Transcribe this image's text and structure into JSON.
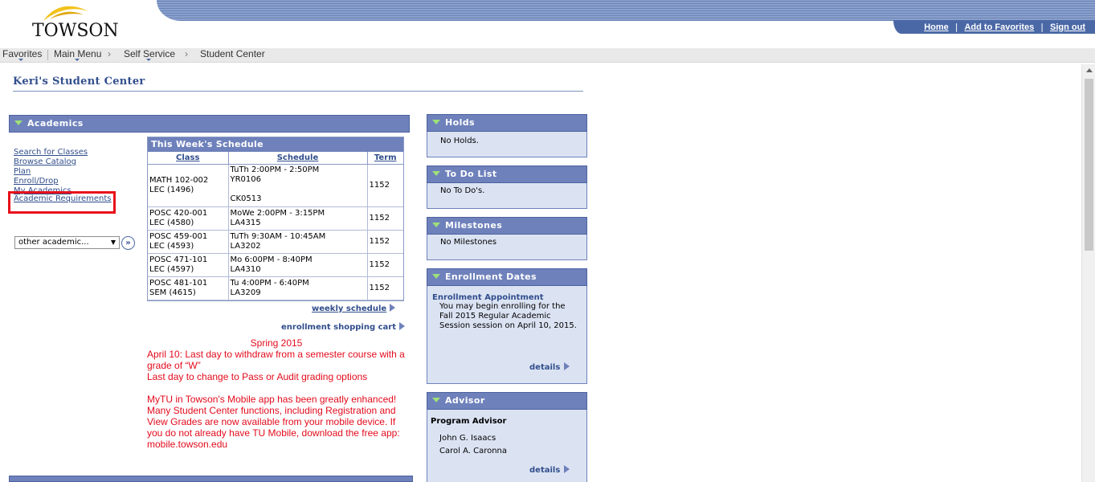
{
  "banner": {
    "logo_text": "TOWSON",
    "links": [
      "Home",
      "Add to Favorites",
      "Sign out"
    ]
  },
  "nav": {
    "favorites": "Favorites",
    "main_menu": "Main Menu",
    "crumbs": [
      "Self Service",
      "Student Center"
    ]
  },
  "page": {
    "title": "Keri's Student Center"
  },
  "academics": {
    "header": "Academics",
    "links": [
      "Search for Classes",
      "Browse Catalog",
      "Plan",
      "Enroll/Drop",
      "My Academics",
      "Academic Requirements"
    ],
    "other_select": "other academic...",
    "go_label": "»"
  },
  "schedule": {
    "caption": "This Week's Schedule",
    "columns": [
      "Class",
      "Schedule",
      "Term"
    ],
    "rows": [
      {
        "class": "MATH 102-002",
        "section": "LEC (1496)",
        "time": "TuTh 2:00PM - 2:50PM",
        "room": "YR0106",
        "extra": "CK0513",
        "term": "1152"
      },
      {
        "class": "POSC 420-001",
        "section": "LEC (4580)",
        "time": "MoWe 2:00PM - 3:15PM",
        "room": "LA4315",
        "extra": "",
        "term": "1152"
      },
      {
        "class": "POSC 459-001",
        "section": "LEC (4593)",
        "time": "TuTh 9:30AM - 10:45AM",
        "room": "LA3202",
        "extra": "",
        "term": "1152"
      },
      {
        "class": "POSC 471-101",
        "section": "LEC (4597)",
        "time": "Mo 6:00PM - 8:40PM",
        "room": "LA4310",
        "extra": "",
        "term": "1152"
      },
      {
        "class": "POSC 481-101",
        "section": "SEM (4615)",
        "time": "Tu 4:00PM - 6:40PM",
        "room": "LA3209",
        "extra": "",
        "term": "1152"
      }
    ],
    "weekly_link": "weekly schedule",
    "cart_link": "enrollment shopping cart"
  },
  "notice": {
    "heading": "Spring 2015",
    "line1": "April 10: Last day to withdraw from a semester course with a grade of “W”",
    "line2": "Last day to change to Pass or Audit grading options",
    "line3": "MyTU in Towson's Mobile app has been greatly enhanced! Many Student Center functions, including Registration and View Grades are now available from your mobile device. If you do not already have TU Mobile, download the free app:",
    "line4": "mobile.towson.edu"
  },
  "holds": {
    "header": "Holds",
    "text": "No Holds."
  },
  "todo": {
    "header": "To Do List",
    "text": "No To Do's."
  },
  "milestones": {
    "header": "Milestones",
    "text": "No Milestones"
  },
  "enrollment_dates": {
    "header": "Enrollment Dates",
    "subheader": "Enrollment Appointment",
    "text": "You may begin enrolling for the Fall 2015 Regular Academic Session session on April 10, 2015.",
    "details": "details"
  },
  "advisor": {
    "header": "Advisor",
    "label": "Program Advisor",
    "names": [
      "John G. Isaacs",
      "Carol A. Caronna"
    ],
    "details": "details"
  }
}
